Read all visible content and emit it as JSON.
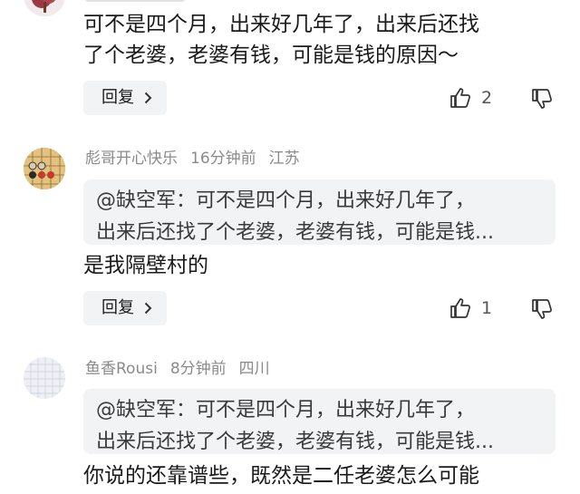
{
  "comments": [
    {
      "text_lines": [
        "可不是四个月，出来好几年了，出来后还找",
        "了个老婆，老婆有钱，可能是钱的原因～"
      ],
      "reply_label": "回复",
      "like_count": "2"
    },
    {
      "username": "彪哥开心快乐",
      "time": "16分钟前",
      "location": "江苏",
      "quote_lines": [
        "@缺空军：可不是四个月，出来好几年了，",
        "出来后还找了个老婆，老婆有钱，可能是钱..."
      ],
      "text": "是我隔壁村的",
      "reply_label": "回复",
      "like_count": "1"
    },
    {
      "username": "鱼香Rousi",
      "time": "8分钟前",
      "location": "四川",
      "quote_lines": [
        "@缺空军：可不是四个月，出来好几年了，",
        "出来后还找了个老婆，老婆有钱，可能是钱..."
      ],
      "text": "你说的还靠谱些，既然是二任老婆怎么可能"
    }
  ],
  "colors": {
    "meta_gray": "#8a8a8a",
    "pill_bg": "#f2f3f5",
    "text": "#1a1a1a"
  },
  "icons": [
    "avatar-tree",
    "avatar-chess",
    "avatar-grid",
    "thumbs-up-icon",
    "thumbs-down-icon",
    "chevron-right-icon"
  ]
}
